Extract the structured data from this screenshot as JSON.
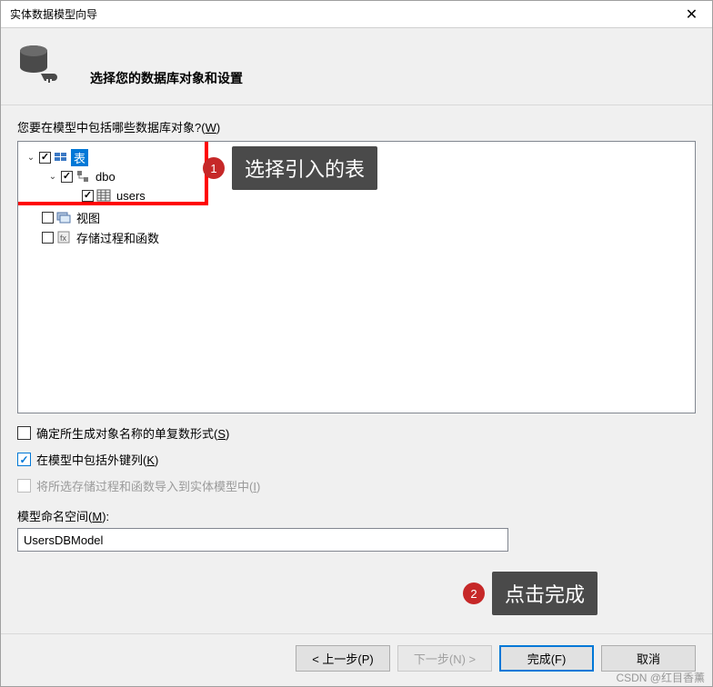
{
  "window": {
    "title": "实体数据模型向导",
    "close_symbol": "✕"
  },
  "header": {
    "subtitle": "选择您的数据库对象和设置"
  },
  "prompt": {
    "text_prefix": "您要在模型中包括哪些数据库对象?(",
    "hotkey": "W",
    "text_suffix": ")"
  },
  "tree": {
    "tables": {
      "label": "表",
      "expanded": true,
      "checked": true
    },
    "dbo": {
      "label": "dbo",
      "expanded": true,
      "checked": true
    },
    "users": {
      "label": "users",
      "checked": true
    },
    "views": {
      "label": "视图",
      "checked": false
    },
    "procs": {
      "label": "存储过程和函数",
      "checked": false
    }
  },
  "annotations": {
    "a1_num": "1",
    "a1_text": "选择引入的表",
    "a2_num": "2",
    "a2_text": "点击完成"
  },
  "options": {
    "pluralize": {
      "label_prefix": "确定所生成对象名称的单复数形式(",
      "hotkey": "S",
      "label_suffix": ")",
      "checked": false
    },
    "fk": {
      "label_prefix": "在模型中包括外键列(",
      "hotkey": "K",
      "label_suffix": ")",
      "checked": true
    },
    "importsp": {
      "label_prefix": "将所选存储过程和函数导入到实体模型中(",
      "hotkey": "I",
      "label_suffix": ")",
      "disabled": true
    }
  },
  "namespace": {
    "label_prefix": "模型命名空间(",
    "hotkey": "M",
    "label_suffix": "):",
    "value": "UsersDBModel"
  },
  "buttons": {
    "back": "< 上一步(P)",
    "next": "下一步(N) >",
    "finish": "完成(F)",
    "cancel": "取消"
  },
  "watermark": "CSDN @红目香薰"
}
